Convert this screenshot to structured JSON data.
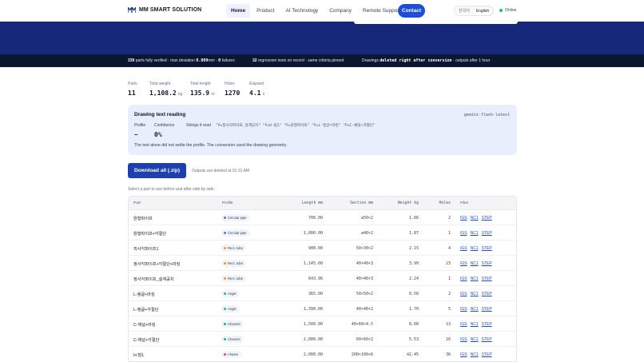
{
  "brand": {
    "name": "MM SMART SOLUTION"
  },
  "nav": {
    "items": [
      "Home",
      "Product",
      "AI Technology",
      "Company",
      "Remote Support"
    ],
    "active": "Home",
    "contact": "Contact"
  },
  "lang": {
    "options": [
      "한국어",
      "English"
    ],
    "selected": "English"
  },
  "status": {
    "label": "Online",
    "color": "#22c55e"
  },
  "strip": {
    "s1_num": "339",
    "s1_a": "parts fully verified · max deviation",
    "s1_dev": "0.009",
    "s1_b": "mm ·",
    "s1_fail": "0",
    "s1_c": "failures",
    "s2_num": "32",
    "s2_text": "regression tests on record · same criteria pinned",
    "s3_a": "Drawings",
    "s3_code": "deleted right after conversion",
    "s3_b": "· outputs after 1 hour"
  },
  "summary": [
    {
      "label": "Parts",
      "value": "11",
      "unit": ""
    },
    {
      "label": "Total weight",
      "value": "1,108.2",
      "unit": "kg"
    },
    {
      "label": "Total length",
      "value": "135.9",
      "unit": "m"
    },
    {
      "label": "Holes",
      "value": "1270",
      "unit": ""
    },
    {
      "label": "Elapsed",
      "value": "4.1",
      "unit": "s"
    }
  ],
  "reading": {
    "title": "Drawing text reading",
    "model": "gemini-flash-latest",
    "profile_label": "Profile",
    "profile_value": "–",
    "confidence_label": "Confidence",
    "confidence_value": "0%",
    "strings_label": "Strings it read",
    "strings": "\"P=정사각파이프_설계공차\"  \"P=H-빔1\"  \"P=원형파이프\"  \"P=L-앵글+마킹\"  \"P=C-채널+각절단\"",
    "note": "The text alone did not settle the profile. The conversion used the drawing geometry."
  },
  "download": {
    "label": "Download all (.zip)",
    "note": "Outputs are deleted at 01:31 AM"
  },
  "select_note": "Select a part to see before and after side by side.",
  "table": {
    "headers": {
      "part": "Part",
      "profile": "Profile",
      "length": "Length mm",
      "section": "Section mm",
      "weight": "Weight kg",
      "holes": "Holes",
      "files": "Files"
    },
    "file_links": [
      "IGS",
      "NC1",
      "STEP"
    ],
    "profile_colors": {
      "Circular pipe": "#3b82f6",
      "Rect. tube": "#f59e0b",
      "Angle": "#22c55e",
      "Channel": "#10b981",
      "I-beam": "#ef4444"
    },
    "rows": [
      {
        "part": "원형파이프",
        "profile": "Circular pipe",
        "length": "700.00",
        "section": "⌀50×2",
        "weight": "1.66",
        "holes": "2"
      },
      {
        "part": "원형파이프+각절단",
        "profile": "Circular pipe",
        "length": "1,000.00",
        "section": "⌀40×2",
        "weight": "1.87",
        "holes": "1"
      },
      {
        "part": "직사각파이프1",
        "profile": "Rect. tube",
        "length": "900.00",
        "section": "50×30×2",
        "weight": "2.15",
        "holes": "4"
      },
      {
        "part": "정사각파이프+각절단+마킹",
        "profile": "Rect. tube",
        "length": "1,145.00",
        "section": "40×40×3",
        "weight": "3.99",
        "holes": "23"
      },
      {
        "part": "정사각파이프_설계공차",
        "profile": "Rect. tube",
        "length": "643.96",
        "section": "40×40×3",
        "weight": "2.24",
        "holes": "1"
      },
      {
        "part": "L-앵글+마킹",
        "profile": "Angle",
        "length": "365.00",
        "section": "50×50×2",
        "weight": "0.56",
        "holes": "2"
      },
      {
        "part": "L-앵글+각절단",
        "profile": "Angle",
        "length": "1,390.00",
        "section": "40×40×2",
        "weight": "1.70",
        "holes": "5"
      },
      {
        "part": "C-채널+마킹",
        "profile": "Channel",
        "length": "1,500.00",
        "section": "40×60×4.5",
        "weight": "8.00",
        "holes": "13"
      },
      {
        "part": "C-채널+각절단",
        "profile": "Channel",
        "length": "2,000.00",
        "section": "60×60×2",
        "weight": "5.53",
        "holes": "16"
      },
      {
        "part": "H-빔1",
        "profile": "I-beam",
        "length": "2,000.00",
        "section": "200×100×6",
        "weight": "42.45",
        "holes": "36"
      }
    ]
  }
}
